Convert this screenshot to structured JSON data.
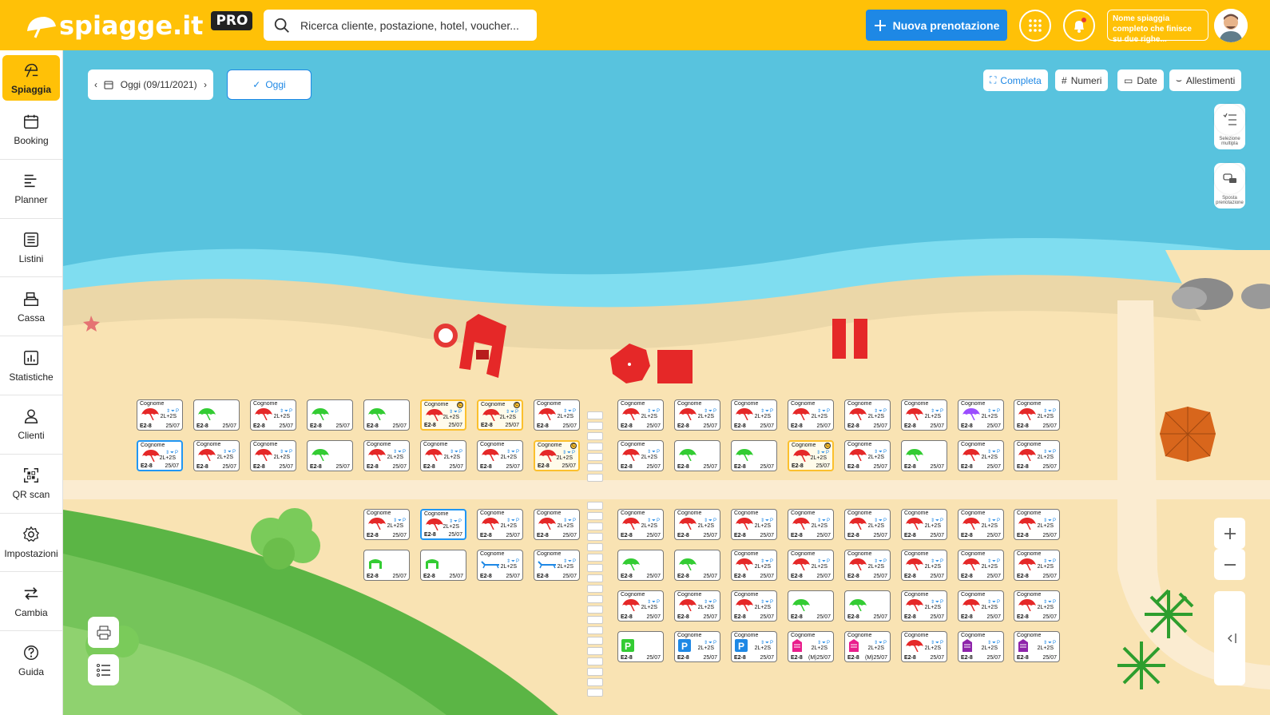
{
  "header": {
    "logo_text": "spiagge.it",
    "logo_badge": "PRO",
    "search_placeholder": "Ricerca cliente, postazione, hotel, voucher...",
    "new_booking_label": "Nuova prenotazione",
    "beach_name": "Nome spiaggia completo che finisce su due righe..."
  },
  "sidebar": {
    "items": [
      {
        "label": "Spiaggia",
        "icon": "beach-umbrella-icon"
      },
      {
        "label": "Booking",
        "icon": "calendar-icon"
      },
      {
        "label": "Planner",
        "icon": "planner-icon"
      },
      {
        "label": "Listini",
        "icon": "list-icon"
      },
      {
        "label": "Cassa",
        "icon": "cash-register-icon"
      },
      {
        "label": "Statistiche",
        "icon": "chart-icon"
      },
      {
        "label": "Clienti",
        "icon": "user-icon"
      },
      {
        "label": "QR scan",
        "icon": "qr-icon"
      },
      {
        "label": "Impostazioni",
        "icon": "gear-icon"
      },
      {
        "label": "Cambia",
        "icon": "swap-icon"
      },
      {
        "label": "Guida",
        "icon": "help-icon"
      }
    ]
  },
  "toolbar": {
    "date_label": "Oggi (09/11/2021)",
    "today_button": "Oggi",
    "view_buttons": [
      "Completa",
      "Numeri",
      "Date",
      "Allestimenti"
    ],
    "multi_select_label": "Selezione multipla",
    "move_booking_label": "Sposta prenotazione"
  },
  "spot_defaults": {
    "name": "Cognome",
    "code": "E2-8",
    "date": "25/07",
    "people": "2L+2S",
    "icons": "⇕⏷P",
    "mark": "C",
    "date_m": "(M)25/07"
  },
  "colors": {
    "accent": "#FFC107",
    "primary": "#1E88E5",
    "umbrella_red": "#E52828",
    "umbrella_green": "#33CC33",
    "umbrella_purple": "#9B4DFF",
    "sea": "#58C3DE",
    "sand": "#F9E3B3"
  },
  "spots": [
    "r",
    "g",
    "r",
    "g",
    "g",
    "rY",
    "rY",
    "r",
    "rH",
    "r",
    "r",
    "g",
    "r",
    "r",
    "r",
    "rY",
    "r",
    "r",
    "r",
    "r",
    "r",
    "r",
    "p",
    "r",
    "r",
    "g",
    "g",
    "rY",
    "r",
    "g",
    "r",
    "r",
    "r",
    "rH",
    "r",
    "r",
    "gc",
    "gc",
    "sb",
    "sb",
    "r",
    "r",
    "r",
    "r",
    "r",
    "r",
    "r",
    "r",
    "g",
    "g",
    "r",
    "r",
    "r",
    "r",
    "r",
    "r",
    "r",
    "r",
    "r",
    "g",
    "g",
    "r",
    "r",
    "r",
    "pkg",
    "pkb",
    "pkb",
    "cab",
    "cab",
    "r",
    "cbv",
    "cbv"
  ]
}
